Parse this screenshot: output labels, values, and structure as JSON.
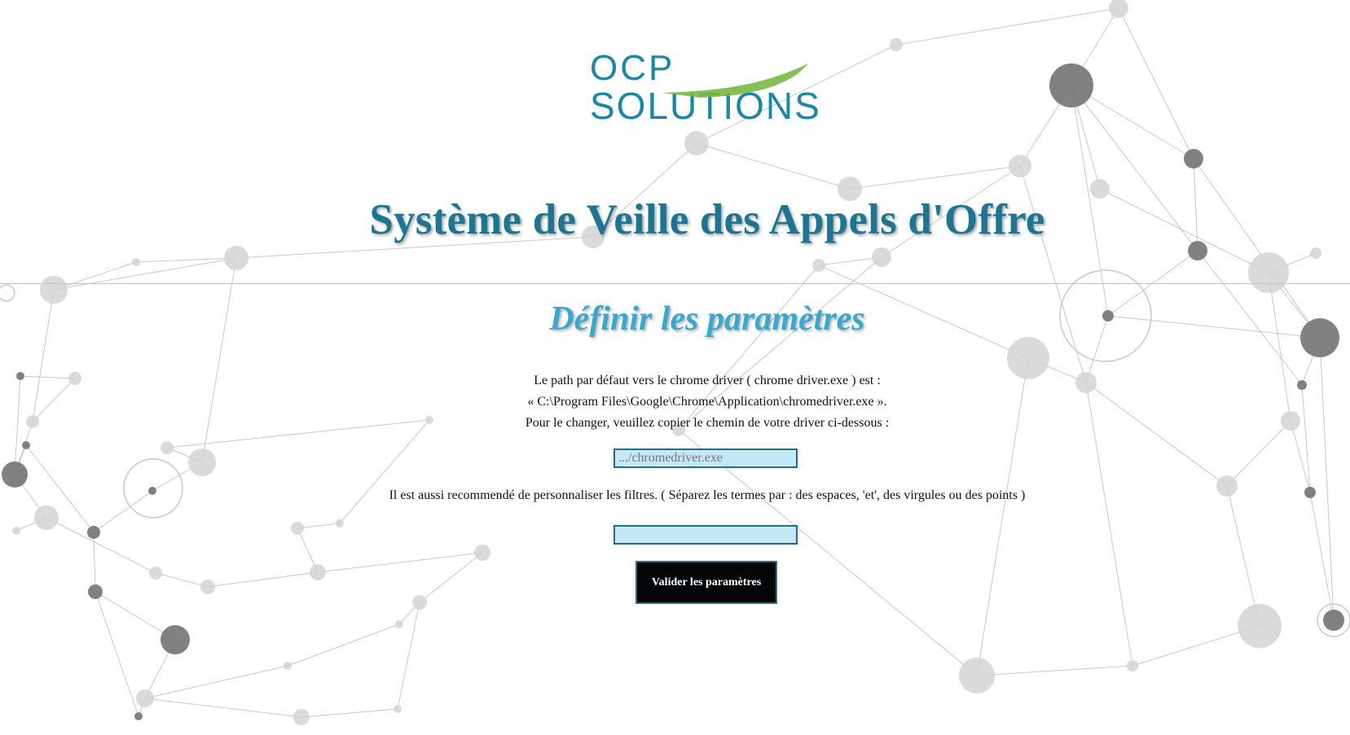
{
  "logo": {
    "line1": "OCP",
    "line2": "SOLUTIONS",
    "primary_color": "#1b86a5",
    "accent_color": "#7ab845"
  },
  "header": {
    "title": "Système de Veille des Appels d'Offre",
    "title_color": "#1f7591"
  },
  "section": {
    "subtitle": "Définir les paramètres",
    "subtitle_color": "#3aa7cd"
  },
  "intro": {
    "line1": "Le path par défaut vers le chrome driver ( chrome driver.exe ) est :",
    "line2": "« C:\\Program Files\\Google\\Chrome\\Application\\chromedriver.exe ».",
    "line3": "Pour le changer, veuillez copier le chemin de votre driver ci-dessous :"
  },
  "driver_path": {
    "placeholder": ".../chromedriver.exe",
    "value": ""
  },
  "filters": {
    "note": "Il est aussi recommendé de personnaliser les filtres. ( Séparez les termes par : des espaces, 'et', des virgules ou des points )",
    "value": ""
  },
  "submit": {
    "label": "Valider les paramètres"
  },
  "background": {
    "node_colors": [
      "#7a7a7a",
      "#d3d3d3"
    ],
    "line_color": "#b5b5b5"
  }
}
